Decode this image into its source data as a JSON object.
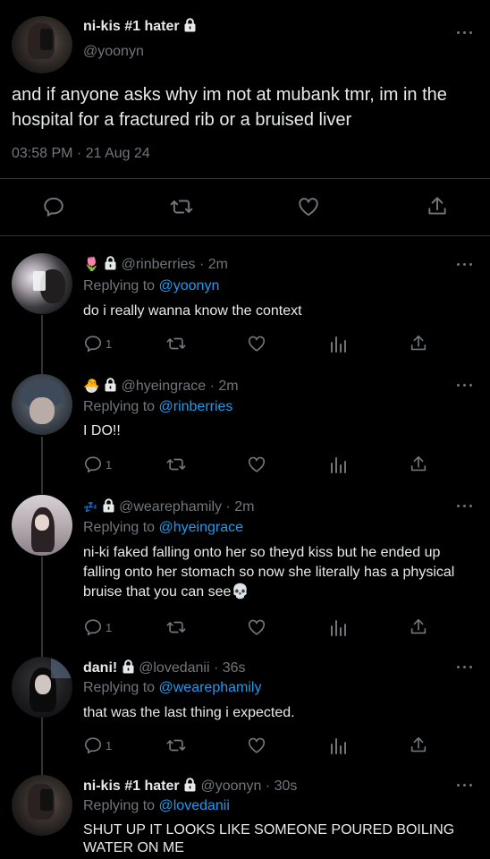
{
  "main_tweet": {
    "display_name": "ni-kis #1 hater",
    "handle": "@yoonyn",
    "text": "and if anyone asks why im not at mubank tmr, im in the hospital for a fractured rib or a bruised liver",
    "timestamp": "03:58 PM · 21 Aug 24",
    "avatar_icon": "profile-photo",
    "action_icons": [
      "reply-icon",
      "retweet-icon",
      "like-icon",
      "share-icon"
    ]
  },
  "replies": [
    {
      "emoji": "🌷",
      "display_name": "",
      "handle": "@rinberries",
      "time": "· 2m",
      "replying_label": "Replying to",
      "replying_to": "@yoonyn",
      "text": "do i really wanna know the context",
      "reply_count": "1"
    },
    {
      "emoji": "🐣",
      "display_name": "",
      "handle": "@hyeingrace",
      "time": "· 2m",
      "replying_label": "Replying to",
      "replying_to": "@rinberries",
      "text": "I DO!!",
      "reply_count": "1"
    },
    {
      "emoji": "💤",
      "display_name": "",
      "handle": "@wearephamily",
      "time": "· 2m",
      "replying_label": "Replying to",
      "replying_to": "@hyeingrace",
      "text": "ni-ki faked falling onto her so theyd kiss but he ended up falling onto her stomach so now she literally has a physical bruise that you can see💀",
      "reply_count": "1"
    },
    {
      "emoji": "",
      "display_name": "dani!",
      "handle": "@lovedanii",
      "time": "· 36s",
      "replying_label": "Replying to",
      "replying_to": "@wearephamily",
      "text": "that was the last thing i expected.",
      "reply_count": "1"
    },
    {
      "emoji": "",
      "display_name": "ni-kis #1 hater",
      "handle": "@yoonyn",
      "time": "· 30s",
      "replying_label": "Replying to",
      "replying_to": "@lovedanii",
      "text": "SHUT UP IT LOOKS LIKE SOMEONE POURED BOILING WATER ON ME",
      "reply_count": ""
    }
  ],
  "colors": {
    "background": "#000000",
    "text": "#e7e9ea",
    "secondary": "#71767b",
    "link": "#1d9bf0",
    "divider": "#2f3336"
  }
}
